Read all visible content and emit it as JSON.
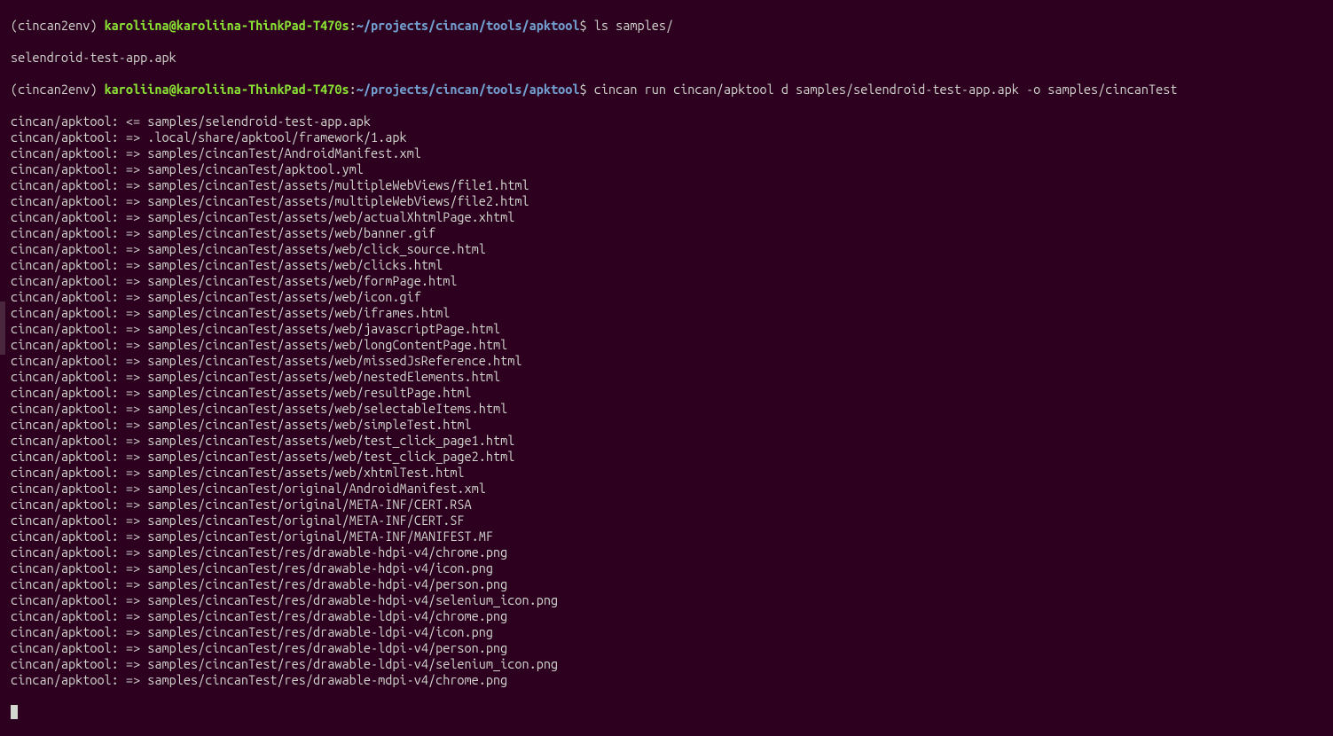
{
  "prompt1": {
    "env": "(cincan2env) ",
    "userhost": "karoliina@karoliina-ThinkPad-T470s",
    "sep": ":",
    "path": "~/projects/cincan/tools/apktool",
    "dollar": "$ ",
    "command": "ls samples/"
  },
  "ls_output": "selendroid-test-app.apk",
  "prompt2": {
    "env": "(cincan2env) ",
    "userhost": "karoliina@karoliina-ThinkPad-T470s",
    "sep": ":",
    "path": "~/projects/cincan/tools/apktool",
    "dollar": "$ ",
    "command": "cincan run cincan/apktool d samples/selendroid-test-app.apk -o samples/cincanTest"
  },
  "tool_lines": [
    "cincan/apktool: <= samples/selendroid-test-app.apk",
    "cincan/apktool: => .local/share/apktool/framework/1.apk",
    "cincan/apktool: => samples/cincanTest/AndroidManifest.xml",
    "cincan/apktool: => samples/cincanTest/apktool.yml",
    "cincan/apktool: => samples/cincanTest/assets/multipleWebViews/file1.html",
    "cincan/apktool: => samples/cincanTest/assets/multipleWebViews/file2.html",
    "cincan/apktool: => samples/cincanTest/assets/web/actualXhtmlPage.xhtml",
    "cincan/apktool: => samples/cincanTest/assets/web/banner.gif",
    "cincan/apktool: => samples/cincanTest/assets/web/click_source.html",
    "cincan/apktool: => samples/cincanTest/assets/web/clicks.html",
    "cincan/apktool: => samples/cincanTest/assets/web/formPage.html",
    "cincan/apktool: => samples/cincanTest/assets/web/icon.gif",
    "cincan/apktool: => samples/cincanTest/assets/web/iframes.html",
    "cincan/apktool: => samples/cincanTest/assets/web/javascriptPage.html",
    "cincan/apktool: => samples/cincanTest/assets/web/longContentPage.html",
    "cincan/apktool: => samples/cincanTest/assets/web/missedJsReference.html",
    "cincan/apktool: => samples/cincanTest/assets/web/nestedElements.html",
    "cincan/apktool: => samples/cincanTest/assets/web/resultPage.html",
    "cincan/apktool: => samples/cincanTest/assets/web/selectableItems.html",
    "cincan/apktool: => samples/cincanTest/assets/web/simpleTest.html",
    "cincan/apktool: => samples/cincanTest/assets/web/test_click_page1.html",
    "cincan/apktool: => samples/cincanTest/assets/web/test_click_page2.html",
    "cincan/apktool: => samples/cincanTest/assets/web/xhtmlTest.html",
    "cincan/apktool: => samples/cincanTest/original/AndroidManifest.xml",
    "cincan/apktool: => samples/cincanTest/original/META-INF/CERT.RSA",
    "cincan/apktool: => samples/cincanTest/original/META-INF/CERT.SF",
    "cincan/apktool: => samples/cincanTest/original/META-INF/MANIFEST.MF",
    "cincan/apktool: => samples/cincanTest/res/drawable-hdpi-v4/chrome.png",
    "cincan/apktool: => samples/cincanTest/res/drawable-hdpi-v4/icon.png",
    "cincan/apktool: => samples/cincanTest/res/drawable-hdpi-v4/person.png",
    "cincan/apktool: => samples/cincanTest/res/drawable-hdpi-v4/selenium_icon.png",
    "cincan/apktool: => samples/cincanTest/res/drawable-ldpi-v4/chrome.png",
    "cincan/apktool: => samples/cincanTest/res/drawable-ldpi-v4/icon.png",
    "cincan/apktool: => samples/cincanTest/res/drawable-ldpi-v4/person.png",
    "cincan/apktool: => samples/cincanTest/res/drawable-ldpi-v4/selenium_icon.png",
    "cincan/apktool: => samples/cincanTest/res/drawable-mdpi-v4/chrome.png"
  ]
}
